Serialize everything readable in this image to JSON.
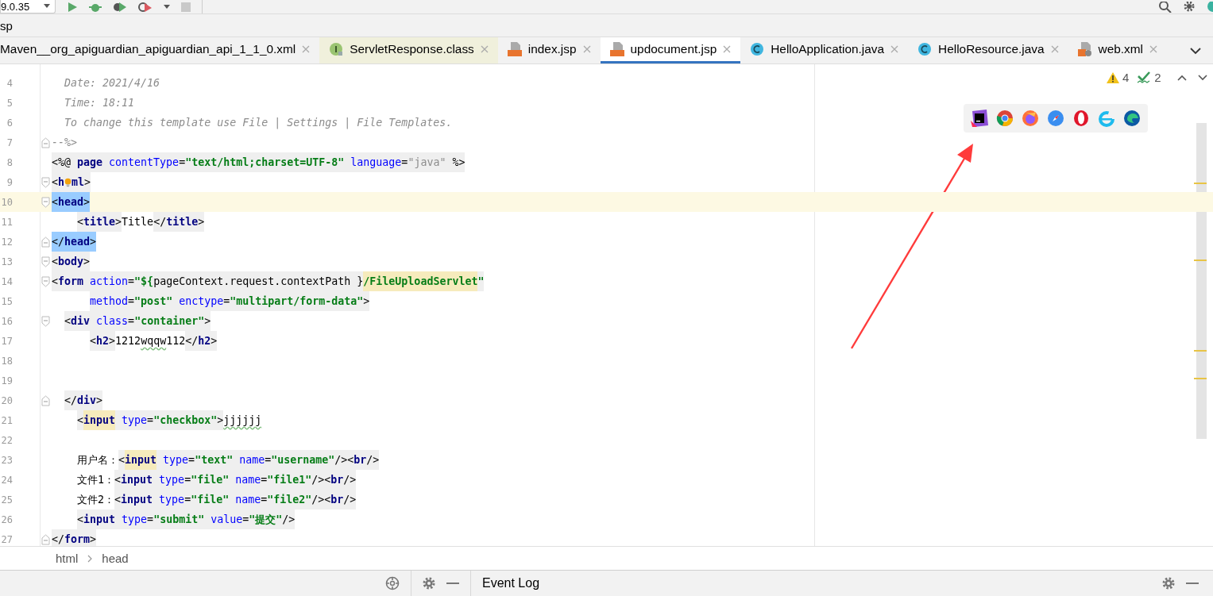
{
  "toolbar": {
    "run_config": "9.0.35"
  },
  "breadcrumb_top": "sp",
  "tabs": [
    {
      "label": "Maven__org_apiguardian_apiguardian_api_1_1_0.xml",
      "kind": "plain",
      "selected": false,
      "library": false
    },
    {
      "label": "ServletResponse.class",
      "kind": "interface",
      "selected": false,
      "library": true
    },
    {
      "label": "index.jsp",
      "kind": "jsp",
      "selected": false,
      "library": false
    },
    {
      "label": "updocument.jsp",
      "kind": "jsp",
      "selected": true,
      "library": false
    },
    {
      "label": "HelloApplication.java",
      "kind": "class",
      "selected": false,
      "library": false
    },
    {
      "label": "HelloResource.java",
      "kind": "class",
      "selected": false,
      "library": false
    },
    {
      "label": "web.xml",
      "kind": "webxml",
      "selected": false,
      "library": false
    }
  ],
  "inspections": {
    "warnings": "4",
    "typos": "2"
  },
  "lines": [
    {
      "number": "4",
      "fold_start": false,
      "fold_end": false,
      "current": false,
      "segments": [
        {
          "shaded": false,
          "tokens": [
            {
              "kind": "comment",
              "text": "  Date: 2021/4/16"
            }
          ]
        }
      ]
    },
    {
      "number": "5",
      "fold_start": false,
      "fold_end": false,
      "current": false,
      "segments": [
        {
          "shaded": false,
          "tokens": [
            {
              "kind": "comment",
              "text": "  Time: 18:11"
            }
          ]
        }
      ]
    },
    {
      "number": "6",
      "fold_start": false,
      "fold_end": false,
      "current": false,
      "segments": [
        {
          "shaded": false,
          "tokens": [
            {
              "kind": "comment",
              "text": "  To change this template use File | Settings | File Templates."
            }
          ]
        }
      ]
    },
    {
      "number": "7",
      "fold_start": false,
      "fold_end": true,
      "current": false,
      "segments": [
        {
          "shaded": false,
          "tokens": [
            {
              "kind": "comment",
              "text": "--%>"
            }
          ]
        }
      ]
    },
    {
      "number": "8",
      "fold_start": false,
      "fold_end": false,
      "current": false,
      "segments": [
        {
          "shaded": true,
          "tokens": [
            {
              "kind": "plain",
              "text": "<%@ "
            },
            {
              "kind": "tag",
              "text": "page"
            },
            {
              "kind": "attr",
              "text": " contentType"
            },
            {
              "kind": "plain",
              "text": "="
            },
            {
              "kind": "string",
              "text": "\"text/html;charset=UTF-8\""
            },
            {
              "kind": "attr",
              "text": " language"
            },
            {
              "kind": "plain",
              "text": "="
            },
            {
              "kind": "grey",
              "text": "\"java\""
            },
            {
              "kind": "plain",
              "text": " %>"
            }
          ]
        }
      ]
    },
    {
      "number": "9",
      "fold_start": true,
      "fold_end": false,
      "current": false,
      "segments": [
        {
          "shaded": true,
          "tokens": [
            {
              "kind": "plain",
              "text": "<"
            },
            {
              "kind": "tag",
              "text": "h"
            },
            {
              "kind": "bulb"
            },
            {
              "kind": "tag",
              "text": "ml"
            },
            {
              "kind": "plain",
              "text": ">"
            }
          ]
        }
      ]
    },
    {
      "number": "10",
      "fold_start": true,
      "fold_end": false,
      "current": true,
      "segments": [
        {
          "tokens": [
            {
              "kind": "plainmatch",
              "text": "<"
            },
            {
              "kind": "tagmatch",
              "text": "head"
            },
            {
              "kind": "plainmatch",
              "text": ">"
            }
          ]
        }
      ]
    },
    {
      "number": "11",
      "fold_start": false,
      "fold_end": false,
      "current": false,
      "segments": [
        {
          "shaded": true,
          "tokens": [
            {
              "kind": "plain",
              "text": "    <"
            },
            {
              "kind": "tag",
              "text": "title"
            },
            {
              "kind": "plain",
              "text": ">"
            }
          ]
        },
        {
          "shaded": false,
          "tokens": [
            {
              "kind": "plain",
              "text": "Title"
            }
          ]
        },
        {
          "shaded": true,
          "tokens": [
            {
              "kind": "plain",
              "text": "</"
            },
            {
              "kind": "tag",
              "text": "title"
            },
            {
              "kind": "plain",
              "text": ">"
            }
          ]
        }
      ]
    },
    {
      "number": "12",
      "fold_start": false,
      "fold_end": true,
      "current": false,
      "segments": [
        {
          "tokens": [
            {
              "kind": "plainmatch",
              "text": "</"
            },
            {
              "kind": "tagmatch",
              "text": "head"
            },
            {
              "kind": "plainmatch",
              "text": ">"
            }
          ]
        }
      ]
    },
    {
      "number": "13",
      "fold_start": true,
      "fold_end": false,
      "current": false,
      "segments": [
        {
          "shaded": true,
          "tokens": [
            {
              "kind": "plain",
              "text": "<"
            },
            {
              "kind": "tag",
              "text": "body"
            },
            {
              "kind": "plain",
              "text": ">"
            }
          ]
        }
      ]
    },
    {
      "number": "14",
      "fold_start": true,
      "fold_end": false,
      "current": false,
      "segments": [
        {
          "shaded": true,
          "tokens": [
            {
              "kind": "plain",
              "text": "<"
            },
            {
              "kind": "tag",
              "text": "form"
            },
            {
              "kind": "attr",
              "text": " action"
            },
            {
              "kind": "plain",
              "text": "="
            },
            {
              "kind": "string",
              "text": "\"${"
            },
            {
              "kind": "plain",
              "text": "pageContext.request.contextPath }"
            },
            {
              "kind": "stringusage",
              "text": "/FileUploadServlet"
            },
            {
              "kind": "string",
              "text": "\""
            }
          ]
        }
      ]
    },
    {
      "number": "15",
      "fold_start": false,
      "fold_end": false,
      "current": false,
      "segments": [
        {
          "shaded": true,
          "tokens": [
            {
              "kind": "attr",
              "text": "      method"
            },
            {
              "kind": "plain",
              "text": "="
            },
            {
              "kind": "string",
              "text": "\"post\""
            },
            {
              "kind": "attr",
              "text": " enctype"
            },
            {
              "kind": "plain",
              "text": "="
            },
            {
              "kind": "string",
              "text": "\"multipart/form-data\""
            },
            {
              "kind": "plain",
              "text": ">"
            }
          ]
        }
      ]
    },
    {
      "number": "16",
      "fold_start": true,
      "fold_end": false,
      "current": false,
      "segments": [
        {
          "shaded": true,
          "tokens": [
            {
              "kind": "plain",
              "text": "  <"
            },
            {
              "kind": "tag",
              "text": "div"
            },
            {
              "kind": "attr",
              "text": " class"
            },
            {
              "kind": "plain",
              "text": "="
            },
            {
              "kind": "string",
              "text": "\"container\""
            },
            {
              "kind": "plain",
              "text": ">"
            }
          ]
        }
      ]
    },
    {
      "number": "17",
      "fold_start": false,
      "fold_end": false,
      "current": false,
      "segments": [
        {
          "shaded": true,
          "tokens": [
            {
              "kind": "plain",
              "text": "      <"
            },
            {
              "kind": "tag",
              "text": "h2"
            },
            {
              "kind": "plain",
              "text": ">"
            }
          ]
        },
        {
          "shaded": false,
          "tokens": [
            {
              "kind": "plain",
              "text": "1212"
            },
            {
              "kind": "plaintypo",
              "text": "wqqw"
            },
            {
              "kind": "plain",
              "text": "112"
            }
          ]
        },
        {
          "shaded": true,
          "tokens": [
            {
              "kind": "plain",
              "text": "</"
            },
            {
              "kind": "tag",
              "text": "h2"
            },
            {
              "kind": "plain",
              "text": ">"
            }
          ]
        }
      ]
    },
    {
      "number": "18",
      "fold_start": false,
      "fold_end": false,
      "current": false
    },
    {
      "number": "19",
      "fold_start": false,
      "fold_end": false,
      "current": false
    },
    {
      "number": "20",
      "fold_start": false,
      "fold_end": true,
      "current": false,
      "segments": [
        {
          "shaded": true,
          "tokens": [
            {
              "kind": "plain",
              "text": "  </"
            },
            {
              "kind": "tag",
              "text": "div"
            },
            {
              "kind": "plain",
              "text": ">"
            }
          ]
        }
      ]
    },
    {
      "number": "21",
      "fold_start": false,
      "fold_end": false,
      "current": false,
      "segments": [
        {
          "shaded": true,
          "tokens": [
            {
              "kind": "plain",
              "text": "    <"
            },
            {
              "kind": "tagusage",
              "text": "input"
            },
            {
              "kind": "attr",
              "text": " type"
            },
            {
              "kind": "plain",
              "text": "="
            },
            {
              "kind": "string",
              "text": "\"checkbox\""
            },
            {
              "kind": "plain",
              "text": ">"
            }
          ]
        },
        {
          "shaded": false,
          "tokens": [
            {
              "kind": "plaintypo",
              "text": "jjjjjj"
            }
          ]
        }
      ]
    },
    {
      "number": "22",
      "fold_start": false,
      "fold_end": false,
      "current": false
    },
    {
      "number": "23",
      "fold_start": false,
      "fold_end": false,
      "current": false,
      "segments": [
        {
          "shaded": false,
          "tokens": [
            {
              "kind": "plain",
              "text": "    用户名："
            }
          ]
        },
        {
          "shaded": true,
          "tokens": [
            {
              "kind": "plain",
              "text": "<"
            },
            {
              "kind": "tagusage",
              "text": "input"
            },
            {
              "kind": "attr",
              "text": " type"
            },
            {
              "kind": "plain",
              "text": "="
            },
            {
              "kind": "string",
              "text": "\"text\""
            },
            {
              "kind": "attr",
              "text": " name"
            },
            {
              "kind": "plain",
              "text": "="
            },
            {
              "kind": "string",
              "text": "\"username\""
            },
            {
              "kind": "plain",
              "text": "/><"
            },
            {
              "kind": "tag",
              "text": "br"
            },
            {
              "kind": "plain",
              "text": "/>"
            }
          ]
        }
      ]
    },
    {
      "number": "24",
      "fold_start": false,
      "fold_end": false,
      "current": false,
      "segments": [
        {
          "shaded": false,
          "tokens": [
            {
              "kind": "plain",
              "text": "    文件1："
            }
          ]
        },
        {
          "shaded": true,
          "tokens": [
            {
              "kind": "plain",
              "text": "<"
            },
            {
              "kind": "tag",
              "text": "input"
            },
            {
              "kind": "attr",
              "text": " type"
            },
            {
              "kind": "plain",
              "text": "="
            },
            {
              "kind": "string",
              "text": "\"file\""
            },
            {
              "kind": "attr",
              "text": " name"
            },
            {
              "kind": "plain",
              "text": "="
            },
            {
              "kind": "string",
              "text": "\"file1\""
            },
            {
              "kind": "plain",
              "text": "/><"
            },
            {
              "kind": "tag",
              "text": "br"
            },
            {
              "kind": "plain",
              "text": "/>"
            }
          ]
        }
      ]
    },
    {
      "number": "25",
      "fold_start": false,
      "fold_end": false,
      "current": false,
      "segments": [
        {
          "shaded": false,
          "tokens": [
            {
              "kind": "plain",
              "text": "    文件2："
            }
          ]
        },
        {
          "shaded": true,
          "tokens": [
            {
              "kind": "plain",
              "text": "<"
            },
            {
              "kind": "tag",
              "text": "input"
            },
            {
              "kind": "attr",
              "text": " type"
            },
            {
              "kind": "plain",
              "text": "="
            },
            {
              "kind": "string",
              "text": "\"file\""
            },
            {
              "kind": "attr",
              "text": " name"
            },
            {
              "kind": "plain",
              "text": "="
            },
            {
              "kind": "string",
              "text": "\"file2\""
            },
            {
              "kind": "plain",
              "text": "/><"
            },
            {
              "kind": "tag",
              "text": "br"
            },
            {
              "kind": "plain",
              "text": "/>"
            }
          ]
        }
      ]
    },
    {
      "number": "26",
      "fold_start": false,
      "fold_end": false,
      "current": false,
      "segments": [
        {
          "shaded": true,
          "tokens": [
            {
              "kind": "plain",
              "text": "    <"
            },
            {
              "kind": "tag",
              "text": "input"
            },
            {
              "kind": "attr",
              "text": " type"
            },
            {
              "kind": "plain",
              "text": "="
            },
            {
              "kind": "string",
              "text": "\"submit\""
            },
            {
              "kind": "attr",
              "text": " value"
            },
            {
              "kind": "plain",
              "text": "="
            },
            {
              "kind": "string",
              "text": "\"提交\""
            },
            {
              "kind": "plain",
              "text": "/>"
            }
          ]
        }
      ]
    },
    {
      "number": "27",
      "fold_start": false,
      "fold_end": true,
      "current": false,
      "segments": [
        {
          "shaded": true,
          "tokens": [
            {
              "kind": "plain",
              "text": "</"
            },
            {
              "kind": "tag",
              "text": "form"
            },
            {
              "kind": "plain",
              "text": ">"
            }
          ]
        }
      ]
    }
  ],
  "breadcrumb_bottom": [
    "html",
    "head"
  ],
  "bottom_bar": {
    "event_log": "Event Log"
  }
}
